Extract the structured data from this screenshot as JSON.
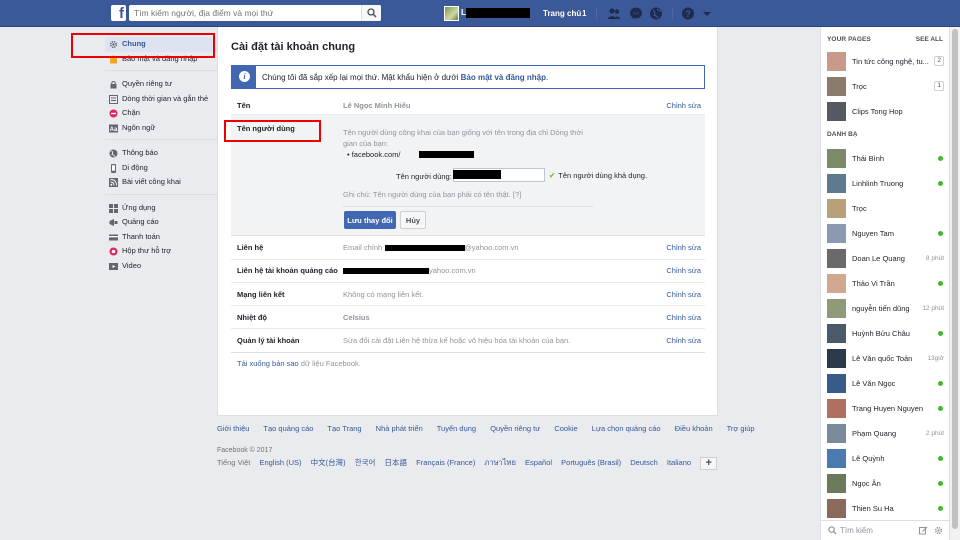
{
  "topbar": {
    "logo": "f",
    "search_placeholder": "Tìm kiếm người, địa điểm và mọi thứ",
    "user_initial": "L",
    "home_label": "Trang chủ",
    "home_count": "1"
  },
  "leftnav": {
    "groups": [
      [
        {
          "label": "Chung",
          "icon": "gear-icon",
          "active": true
        },
        {
          "label": "Bảo mật và đăng nhập",
          "icon": "shield-icon"
        }
      ],
      [
        {
          "label": "Quyền riêng tư",
          "icon": "lock-icon"
        },
        {
          "label": "Dòng thời gian và gắn thẻ",
          "icon": "timeline-icon"
        },
        {
          "label": "Chặn",
          "icon": "block-icon"
        },
        {
          "label": "Ngôn ngữ",
          "icon": "language-icon"
        }
      ],
      [
        {
          "label": "Thông báo",
          "icon": "globe-icon"
        },
        {
          "label": "Di động",
          "icon": "mobile-icon"
        },
        {
          "label": "Bài viết công khai",
          "icon": "rss-icon"
        }
      ],
      [
        {
          "label": "Ứng dụng",
          "icon": "apps-icon"
        },
        {
          "label": "Quảng cáo",
          "icon": "ads-icon"
        },
        {
          "label": "Thanh toán",
          "icon": "payment-icon"
        },
        {
          "label": "Hộp thư hỗ trợ",
          "icon": "support-icon"
        },
        {
          "label": "Video",
          "icon": "video-icon"
        }
      ]
    ]
  },
  "main": {
    "title": "Cài đặt tài khoản chung",
    "notice_text": "Chúng tôi đã sắp xếp lại mọi thứ. Mật khẩu hiện ở dưới",
    "notice_link": "Bảo mật và đăng nhập",
    "notice_end": ".",
    "edit_label": "Chỉnh sửa",
    "name_row": {
      "label": "Tên",
      "value": "Lê Ngọc Minh Hiếu"
    },
    "username": {
      "label": "Tên người dùng",
      "desc": "Tên người dùng công khai của bạn giống với tên trong địa chỉ Dòng thời gian của bạn:",
      "url_prefix": "• facebook.com/",
      "field_label": "Tên người dùng:",
      "available": "Tên người dùng khả dụng.",
      "note": "Ghi chú: Tên người dùng của bạn phải có tên thật. [?]",
      "save": "Lưu thay đổi",
      "cancel": "Hủy"
    },
    "rows": [
      {
        "label": "Liên hệ",
        "value_prefix": "Email chính",
        "value_suffix": "@yahoo.com.vn",
        "edit": true
      },
      {
        "label": "Liên hệ tài khoản quảng cáo",
        "value_prefix": "",
        "value_suffix": "yahoo.com.vn",
        "edit": true
      },
      {
        "label": "Mạng liên kết",
        "value": "Không có mạng liên kết.",
        "edit": true
      },
      {
        "label": "Nhiệt độ",
        "value": "Celsius",
        "edit": true
      },
      {
        "label": "Quản lý tài khoản",
        "value": "Sửa đổi cài đặt Liên hệ thừa kế hoặc vô hiệu hóa tài khoản của bạn.",
        "edit": true
      }
    ],
    "download_link": "Tải xuống bản sao",
    "download_rest": " dữ liệu Facebook."
  },
  "footer": {
    "links": [
      "Giới thiệu",
      "Tạo quảng cáo",
      "Tạo Trang",
      "Nhà phát triển",
      "Tuyển dụng",
      "Quyền riêng tư",
      "Cookie",
      "Lựa chọn quảng cáo",
      "Điều khoản",
      "Trợ giúp"
    ],
    "copyright": "Facebook © 2017",
    "current_lang": "Tiếng Việt",
    "langs": [
      "English (US)",
      "中文(台灣)",
      "한국어",
      "日本語",
      "Français (France)",
      "ภาษาไทย",
      "Español",
      "Português (Brasil)",
      "Deutsch",
      "Italiano"
    ],
    "add": "+"
  },
  "rightbar": {
    "pages_title": "YOUR PAGES",
    "see_all": "SEE ALL",
    "pages": [
      {
        "name": "Tin tức công nghệ, tu...",
        "count": "2",
        "color": "#c99a8a"
      },
      {
        "name": "Trọc",
        "count": "1",
        "color": "#8c7b6a"
      },
      {
        "name": "Clips Tong Hop",
        "count": "",
        "color": "#555a60"
      }
    ],
    "contacts_title": "DANH BẠ",
    "contacts": [
      {
        "name": "Thái Bình",
        "status": "online",
        "color": "#7d8a6a"
      },
      {
        "name": "Linhlinh Truong",
        "status": "online",
        "color": "#5d7a8f"
      },
      {
        "name": "Trọc",
        "status": "",
        "color": "#b8a07a"
      },
      {
        "name": "Nguyen Tam",
        "status": "online",
        "color": "#8a9ab0"
      },
      {
        "name": "Doan Le Quang",
        "status": "8 phút",
        "color": "#6a6a6a"
      },
      {
        "name": "Thảo Vi Trần",
        "status": "online",
        "color": "#d0a890"
      },
      {
        "name": "nguyễn tiến dũng",
        "status": "12 phút",
        "color": "#8f9a7a"
      },
      {
        "name": "Huỳnh Bửu Châu",
        "status": "online",
        "color": "#4a5a6a"
      },
      {
        "name": "Lê Văn quốc Toản",
        "status": "13giờ",
        "color": "#2a3a4a"
      },
      {
        "name": "Lê Văn Ngọc",
        "status": "online",
        "color": "#3a5a8a"
      },
      {
        "name": "Trang Huyen Nguyen",
        "status": "online",
        "color": "#b07060"
      },
      {
        "name": "Phạm Quang",
        "status": "2 phút",
        "color": "#7a8a9a"
      },
      {
        "name": "Lê Quỳnh",
        "status": "online",
        "color": "#4a7ab0"
      },
      {
        "name": "Ngọc Ân",
        "status": "online",
        "color": "#6a7a5a"
      },
      {
        "name": "Thien Su Ha",
        "status": "online",
        "color": "#8a6a5a"
      }
    ],
    "search_placeholder": "Tìm kiếm"
  }
}
